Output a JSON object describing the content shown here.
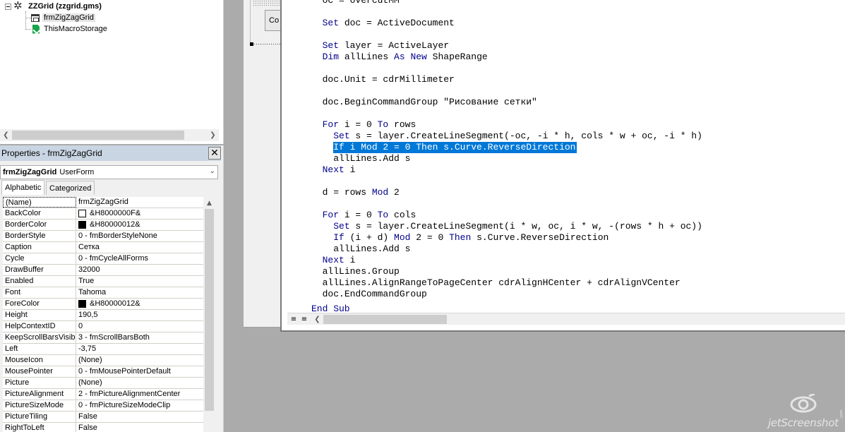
{
  "project_tree": {
    "project_label": "ZZGrid (zzgrid.gms)",
    "items": [
      {
        "label": "frmZigZagGrid",
        "icon": "userform-icon"
      },
      {
        "label": "ThisMacroStorage",
        "icon": "macro-storage-icon"
      }
    ]
  },
  "properties": {
    "title": "Properties - frmZigZagGrid",
    "object_name": "frmZigZagGrid",
    "object_type": "UserForm",
    "tabs": [
      "Alphabetic",
      "Categorized"
    ],
    "active_tab": "Alphabetic",
    "rows": [
      {
        "name": "(Name)",
        "value": "frmZigZagGrid"
      },
      {
        "name": "BackColor",
        "value": "&H8000000F&",
        "swatch": "#ffffff"
      },
      {
        "name": "BorderColor",
        "value": "&H80000012&",
        "swatch": "#000000"
      },
      {
        "name": "BorderStyle",
        "value": "0 - fmBorderStyleNone"
      },
      {
        "name": "Caption",
        "value": "Сетка"
      },
      {
        "name": "Cycle",
        "value": "0 - fmCycleAllForms"
      },
      {
        "name": "DrawBuffer",
        "value": "32000"
      },
      {
        "name": "Enabled",
        "value": "True"
      },
      {
        "name": "Font",
        "value": "Tahoma"
      },
      {
        "name": "ForeColor",
        "value": "&H80000012&",
        "swatch": "#000000"
      },
      {
        "name": "Height",
        "value": "190,5"
      },
      {
        "name": "HelpContextID",
        "value": "0"
      },
      {
        "name": "KeepScrollBarsVisible",
        "value": "3 - fmScrollBarsBoth"
      },
      {
        "name": "Left",
        "value": "-3,75"
      },
      {
        "name": "MouseIcon",
        "value": "(None)"
      },
      {
        "name": "MousePointer",
        "value": "0 - fmMousePointerDefault"
      },
      {
        "name": "Picture",
        "value": "(None)"
      },
      {
        "name": "PictureAlignment",
        "value": "2 - fmPictureAlignmentCenter"
      },
      {
        "name": "PictureSizeMode",
        "value": "0 - fmPictureSizeModeClip"
      },
      {
        "name": "PictureTiling",
        "value": "False"
      },
      {
        "name": "RightToLeft",
        "value": "False"
      }
    ]
  },
  "designer": {
    "button_caption": "Co"
  },
  "code": {
    "lines": [
      {
        "indent": "  ",
        "parts": [
          {
            "t": "oc = overcutMM"
          }
        ]
      },
      {
        "indent": "",
        "parts": []
      },
      {
        "indent": "  ",
        "parts": [
          {
            "t": "Set",
            "kw": true
          },
          {
            "t": " doc = ActiveDocument"
          }
        ]
      },
      {
        "indent": "",
        "parts": []
      },
      {
        "indent": "  ",
        "parts": [
          {
            "t": "Set",
            "kw": true
          },
          {
            "t": " layer = ActiveLayer"
          }
        ]
      },
      {
        "indent": "  ",
        "parts": [
          {
            "t": "Dim",
            "kw": true
          },
          {
            "t": " allLines "
          },
          {
            "t": "As",
            "kw": true
          },
          {
            "t": " "
          },
          {
            "t": "New",
            "kw": true
          },
          {
            "t": " ShapeRange"
          }
        ]
      },
      {
        "indent": "",
        "parts": []
      },
      {
        "indent": "  ",
        "parts": [
          {
            "t": "doc.Unit = cdrMillimeter"
          }
        ]
      },
      {
        "indent": "",
        "parts": []
      },
      {
        "indent": "  ",
        "parts": [
          {
            "t": "doc.BeginCommandGroup \"Рисование сетки\""
          }
        ]
      },
      {
        "indent": "",
        "parts": []
      },
      {
        "indent": "  ",
        "parts": [
          {
            "t": "For",
            "kw": true
          },
          {
            "t": " i = 0 "
          },
          {
            "t": "To",
            "kw": true
          },
          {
            "t": " rows"
          }
        ]
      },
      {
        "indent": "    ",
        "parts": [
          {
            "t": "Set",
            "kw": true
          },
          {
            "t": " s = layer.CreateLineSegment(-oc, -i * h, cols * w + oc, -i * h)"
          }
        ]
      },
      {
        "indent": "    ",
        "highlight": true,
        "parts": [
          {
            "t": "If i Mod 2 = 0 Then s.Curve.ReverseDirection"
          }
        ]
      },
      {
        "indent": "    ",
        "parts": [
          {
            "t": "allLines.Add s"
          }
        ]
      },
      {
        "indent": "  ",
        "parts": [
          {
            "t": "Next",
            "kw": true
          },
          {
            "t": " i"
          }
        ]
      },
      {
        "indent": "",
        "parts": []
      },
      {
        "indent": "  ",
        "parts": [
          {
            "t": "d = rows "
          },
          {
            "t": "Mod",
            "kw": true
          },
          {
            "t": " 2"
          }
        ]
      },
      {
        "indent": "",
        "parts": []
      },
      {
        "indent": "  ",
        "parts": [
          {
            "t": "For",
            "kw": true
          },
          {
            "t": " i = 0 "
          },
          {
            "t": "To",
            "kw": true
          },
          {
            "t": " cols"
          }
        ]
      },
      {
        "indent": "    ",
        "parts": [
          {
            "t": "Set",
            "kw": true
          },
          {
            "t": " s = layer.CreateLineSegment(i * w, oc, i * w, -(rows * h + oc))"
          }
        ]
      },
      {
        "indent": "    ",
        "parts": [
          {
            "t": "If",
            "kw": true
          },
          {
            "t": " (i + d) "
          },
          {
            "t": "Mod",
            "kw": true
          },
          {
            "t": " 2 = 0 "
          },
          {
            "t": "Then",
            "kw": true
          },
          {
            "t": " s.Curve.ReverseDirection"
          }
        ]
      },
      {
        "indent": "    ",
        "parts": [
          {
            "t": "allLines.Add s"
          }
        ]
      },
      {
        "indent": "  ",
        "parts": [
          {
            "t": "Next",
            "kw": true
          },
          {
            "t": " i"
          }
        ]
      },
      {
        "indent": "  ",
        "parts": [
          {
            "t": "allLines.Group"
          }
        ]
      },
      {
        "indent": "  ",
        "parts": [
          {
            "t": "allLines.AlignRangeToPageCenter cdrAlignHCenter + cdrAlignVCenter"
          }
        ]
      },
      {
        "indent": "  ",
        "parts": [
          {
            "t": "doc.EndCommandGroup"
          }
        ]
      },
      {
        "indent": "",
        "parts": [
          {
            "t": "End Sub",
            "kw": true
          }
        ]
      }
    ]
  },
  "watermark": {
    "text": "jetScreenshot",
    "suffix": ".com"
  },
  "colors": {
    "selection": "#0078d7",
    "keyword": "#00008b",
    "title_bar": "#c9d5e2"
  }
}
